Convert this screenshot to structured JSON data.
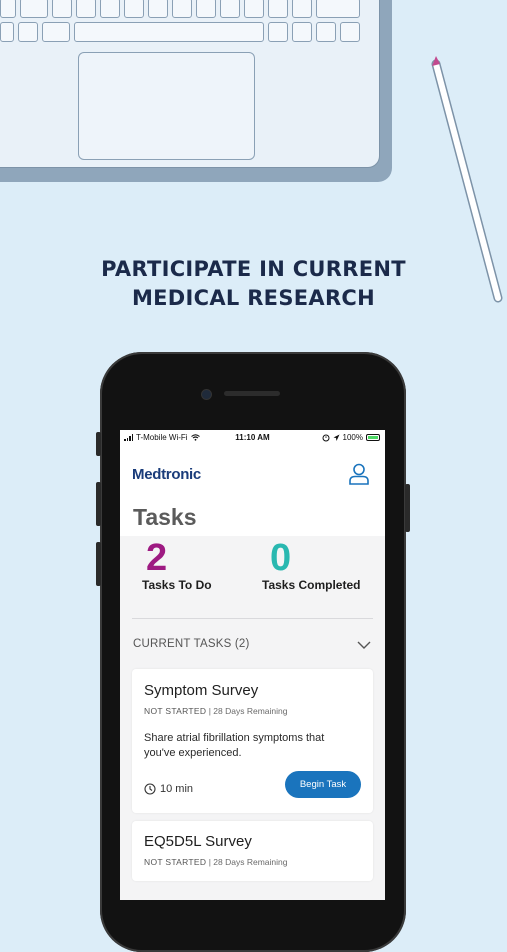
{
  "headline": {
    "line1": "PARTICIPATE IN CURRENT",
    "line2": "MEDICAL RESEARCH"
  },
  "status_bar": {
    "carrier": "T-Mobile Wi-Fi",
    "time": "11:10 AM",
    "battery": "100%"
  },
  "header": {
    "logo": "Medtronic",
    "title": "Tasks"
  },
  "stats": {
    "todo": {
      "count": "2",
      "label": "Tasks To Do"
    },
    "completed": {
      "count": "0",
      "label": "Tasks Completed"
    }
  },
  "current_tasks": {
    "header": "CURRENT TASKS (2)",
    "tasks": [
      {
        "title": "Symptom Survey",
        "status": "NOT STARTED",
        "remaining": "| 28 Days Remaining",
        "description": "Share atrial fibrillation symptoms that you've experienced.",
        "duration": "10 min",
        "button": "Begin Task"
      },
      {
        "title": "EQ5D5L Survey",
        "status": "NOT STARTED",
        "remaining": "| 28 Days Remaining"
      }
    ]
  },
  "colors": {
    "background": "#dcedf8",
    "todo_accent": "#9e1a82",
    "completed_accent": "#29b8b0",
    "primary_button": "#1a74bd",
    "logo": "#1a3c7a"
  },
  "icons": [
    "signal-icon",
    "wifi-icon",
    "alarm-icon",
    "battery-icon",
    "profile-icon",
    "chevron-down-icon",
    "clock-icon"
  ]
}
